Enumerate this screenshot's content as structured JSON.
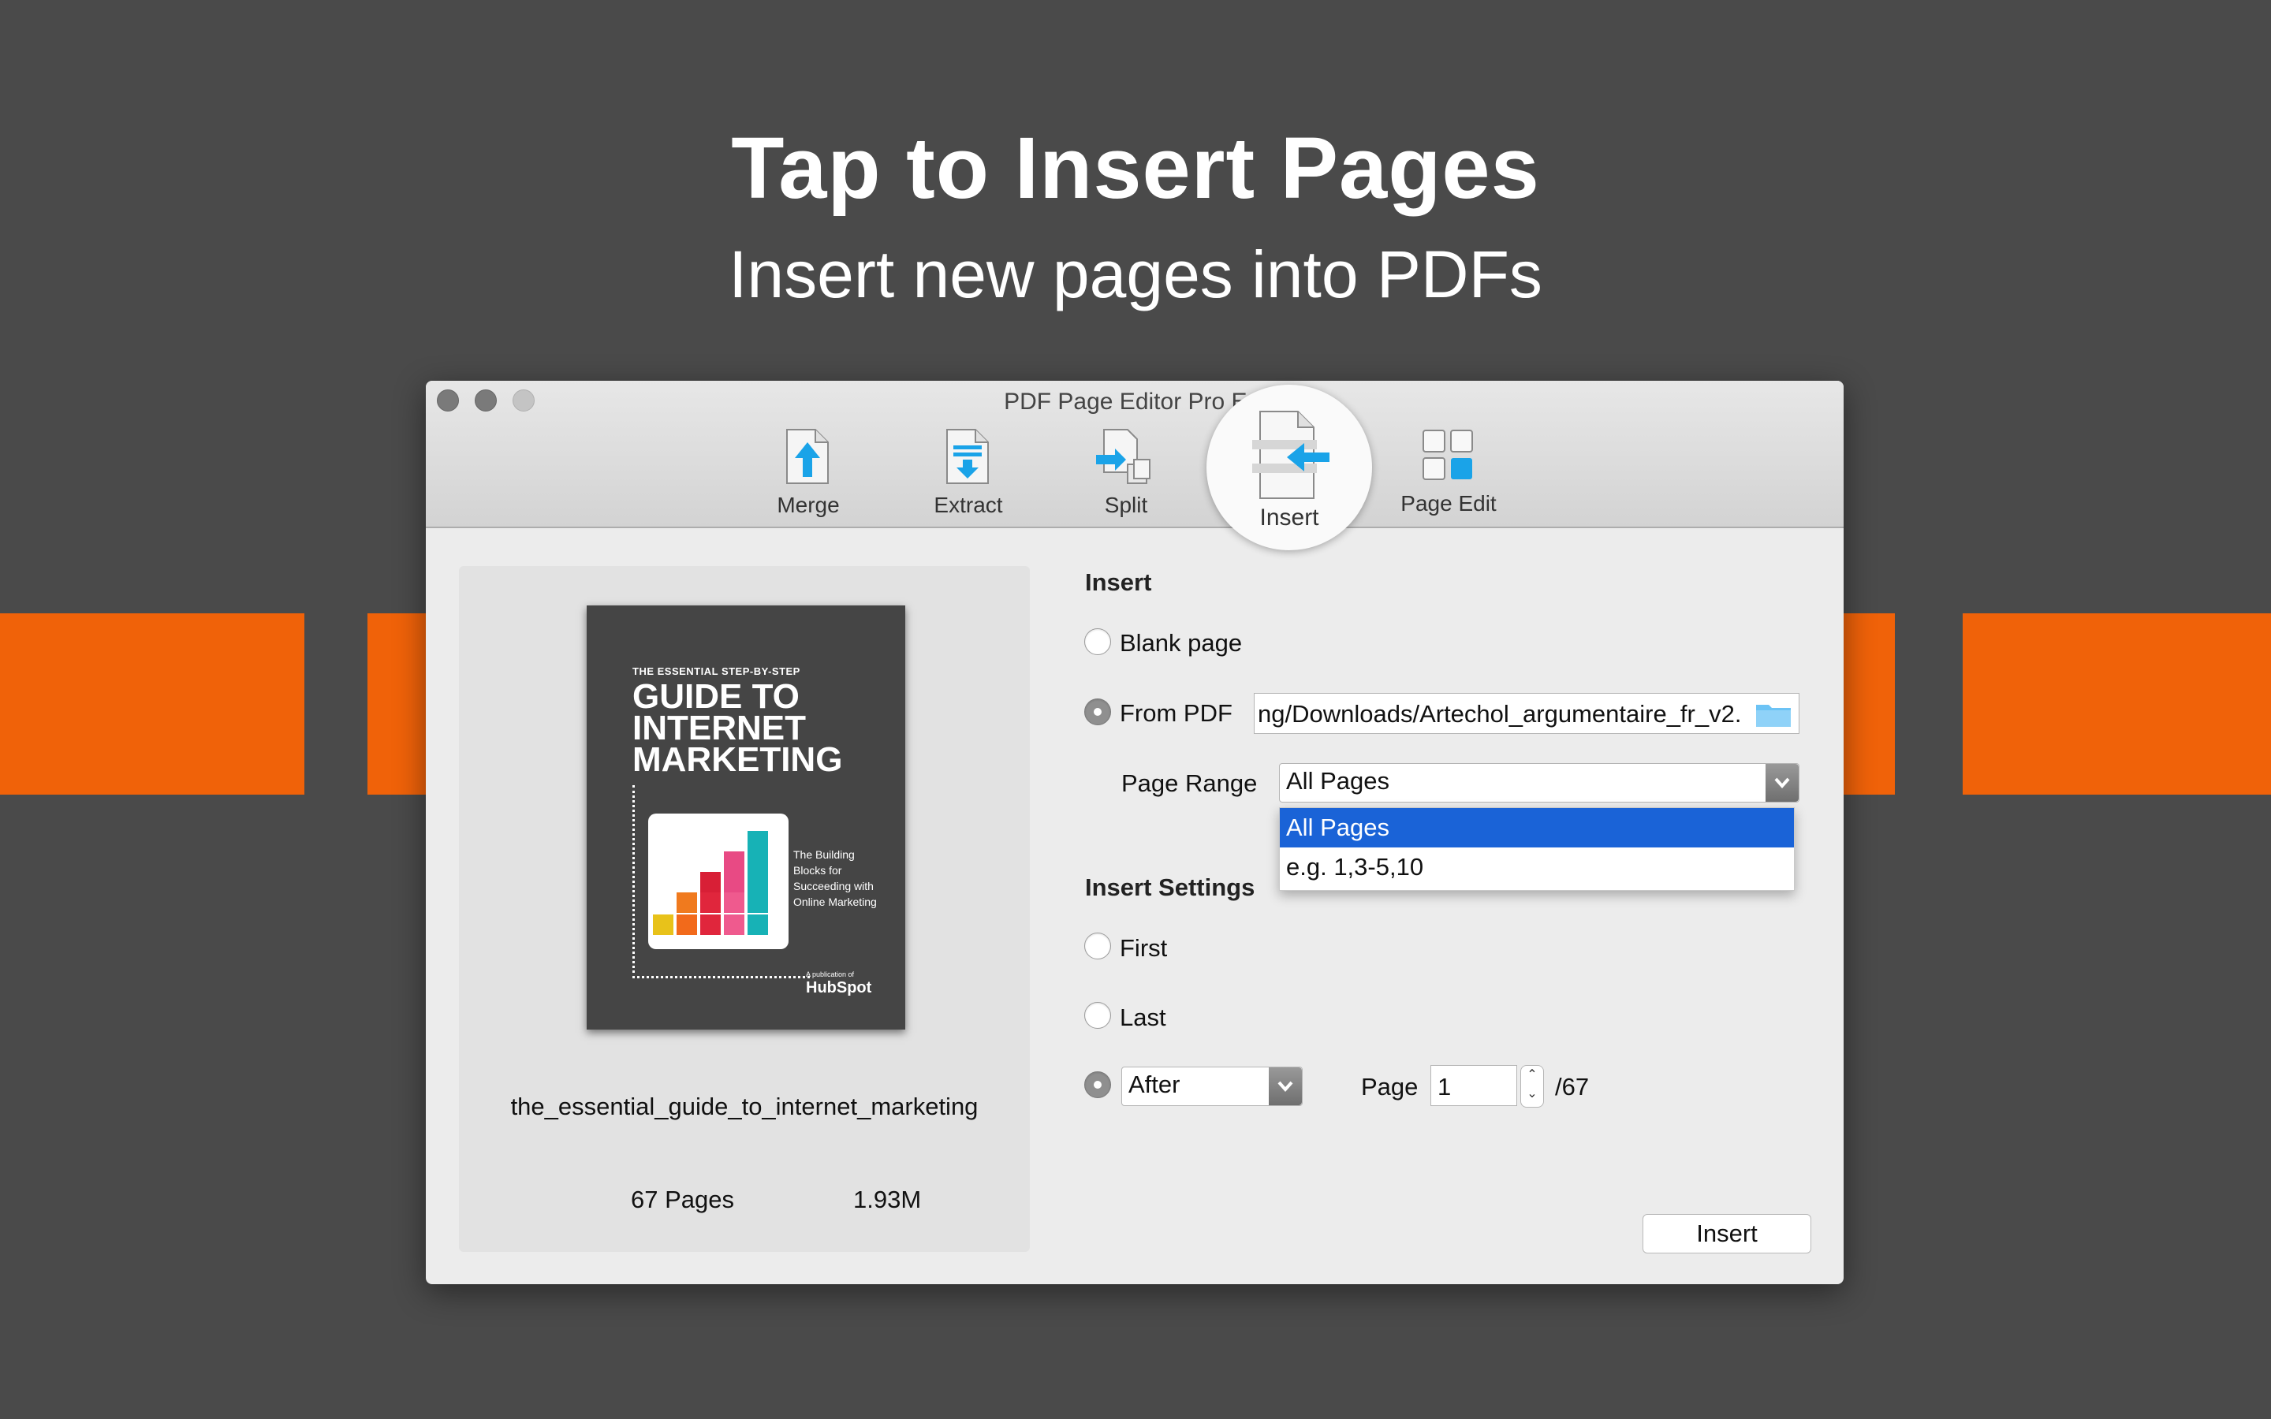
{
  "headline": {
    "title": "Tap to Insert Pages",
    "subtitle": "Insert new pages into PDFs"
  },
  "window": {
    "title": "PDF Page Editor Pro Edi",
    "toolbar": {
      "merge": "Merge",
      "extract": "Extract",
      "split": "Split",
      "insert": "Insert",
      "page_edit": "Page Edit"
    }
  },
  "document": {
    "cover": {
      "pre": "THE ESSENTIAL STEP-BY-STEP",
      "line1": "GUIDE TO",
      "line2": "INTERNET",
      "line3": "MARKETING",
      "blurb1": "The Building",
      "blurb2": "Blocks for",
      "blurb3": "Succeeding with",
      "blurb4": "Online Marketing",
      "pub": "A publication of",
      "brand": "HubSpot"
    },
    "name": "the_essential_guide_to_internet_marketing",
    "pages": "67 Pages",
    "size": "1.93M"
  },
  "form": {
    "insert_heading": "Insert",
    "blank_page": "Blank page",
    "from_pdf": "From PDF",
    "path": "ng/Downloads/Artechol_argumentaire_fr_v2.",
    "page_range_label": "Page Range",
    "page_range_value": "All Pages",
    "dropdown": {
      "option1": "All Pages",
      "option2": "e.g. 1,3-5,10"
    },
    "settings_heading": "Insert Settings",
    "first": "First",
    "last": "Last",
    "position_value": "After",
    "page_label": "Page",
    "page_value": "1",
    "page_total": "/67",
    "insert_button": "Insert"
  },
  "colors": {
    "background": "#4a4a4a",
    "stripe": "#f06209",
    "accent_blue": "#1aa3e8",
    "selection": "#1a63d7"
  }
}
